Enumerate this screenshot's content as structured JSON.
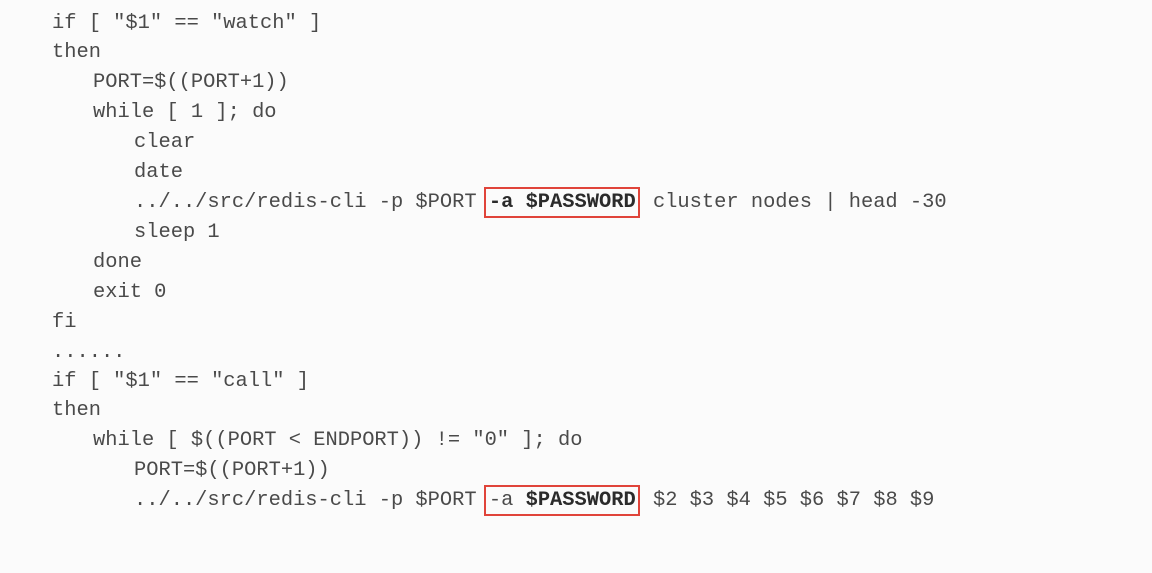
{
  "code": {
    "lines": [
      {
        "segments": [
          {
            "text": "if [ \"$1\" == \"watch\" ]"
          }
        ]
      },
      {
        "segments": [
          {
            "text": "then"
          }
        ]
      },
      {
        "segments": [
          {
            "text": "PORT=$((PORT+1))"
          }
        ]
      },
      {
        "segments": [
          {
            "text": "while [ 1 ]; do"
          }
        ]
      },
      {
        "segments": [
          {
            "text": "clear"
          }
        ]
      },
      {
        "segments": [
          {
            "text": "date"
          }
        ]
      },
      {
        "segments": [
          {
            "text": "../../src/redis-cli -p $PORT "
          },
          {
            "text": "-a $PASSWORD"
          },
          {
            "text": " cluster nodes | head -30"
          }
        ]
      },
      {
        "segments": [
          {
            "text": "sleep 1"
          }
        ]
      },
      {
        "segments": [
          {
            "text": "done"
          }
        ]
      },
      {
        "segments": [
          {
            "text": "exit 0"
          }
        ]
      },
      {
        "segments": [
          {
            "text": "fi"
          }
        ]
      },
      {
        "segments": [
          {
            "text": "......"
          }
        ]
      },
      {
        "segments": [
          {
            "text": "if [ \"$1\" == \"call\" ]"
          }
        ]
      },
      {
        "segments": [
          {
            "text": "then"
          }
        ]
      },
      {
        "segments": [
          {
            "text": "while [ $((PORT < ENDPORT)) != \"0\" ]; do"
          }
        ]
      },
      {
        "segments": [
          {
            "text": "PORT=$((PORT+1))"
          }
        ]
      },
      {
        "segments": [
          {
            "text": "../../src/redis-cli -p $PORT "
          },
          {
            "text": "-a "
          },
          {
            "text": "$PASSWORD"
          },
          {
            "text": " $2 $3 $4 $5 $6 $7 $8 $9"
          }
        ]
      }
    ]
  },
  "highlight_color": "#e0443a"
}
